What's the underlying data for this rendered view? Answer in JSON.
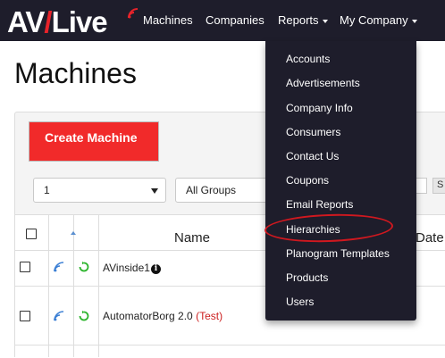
{
  "navbar": {
    "logo": "AVLive",
    "links": [
      {
        "label": "Machines",
        "has_caret": false
      },
      {
        "label": "Companies",
        "has_caret": false
      },
      {
        "label": "Reports",
        "has_caret": true
      },
      {
        "label": "My Company",
        "has_caret": true
      }
    ]
  },
  "page": {
    "title": "Machines",
    "create_button": "Create Machine",
    "page_size_select": "1",
    "group_select": "All Groups",
    "right_button": "S"
  },
  "table": {
    "headers": {
      "name": "Name",
      "date": "Date"
    },
    "rows": [
      {
        "name": "AVinside1",
        "tag": "",
        "has_info_icon": true
      },
      {
        "name": "AutomatorBorg 2.0",
        "tag": "(Test)",
        "has_info_icon": false
      }
    ]
  },
  "dropdown": {
    "items": [
      "Accounts",
      "Advertisements",
      "Company Info",
      "Consumers",
      "Contact Us",
      "Coupons",
      "Email Reports",
      "Hierarchies",
      "Planogram Templates",
      "Products",
      "Users"
    ],
    "highlighted": "Hierarchies"
  },
  "colors": {
    "navbar_bg": "#1e1d2b",
    "brand_red": "#e8232a",
    "create_button_bg": "#f12a2a",
    "highlight": "#d0181f",
    "wifi_icon": "#3b7fd4",
    "sync_icon": "#2db52d",
    "test_tag": "#cc1f1f"
  }
}
